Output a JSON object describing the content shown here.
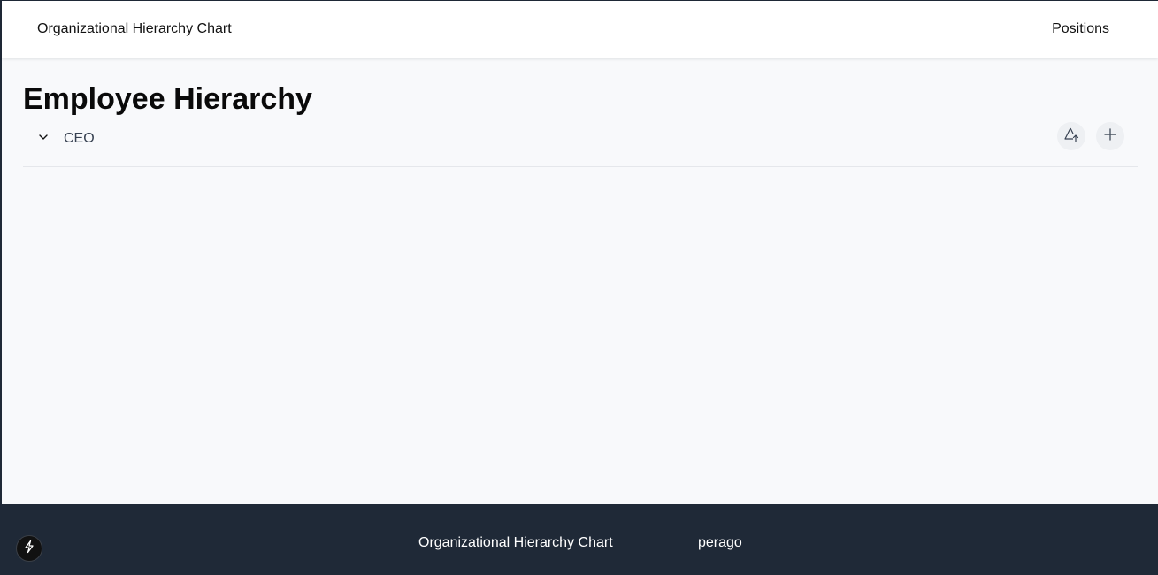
{
  "header": {
    "brand": "Organizational Hierarchy Chart",
    "nav": {
      "positions_label": "Positions"
    }
  },
  "main": {
    "title": "Employee Hierarchy",
    "tree": [
      {
        "label": "CEO",
        "expanded": true,
        "toggle_icon": "chevron-down-icon"
      }
    ],
    "actions": [
      {
        "icon": "vector-shape-up-icon"
      },
      {
        "icon": "plus-icon"
      }
    ]
  },
  "footer": {
    "title": "Organizational Hierarchy Chart",
    "brand": "perago",
    "badge_icon": "bolt-icon"
  },
  "colors": {
    "header_bg": "#ffffff",
    "page_bg": "#f8f9fb",
    "footer_bg": "#1f2937",
    "footer_text": "#ffffff",
    "icon_button_bg": "#eef0f3"
  }
}
